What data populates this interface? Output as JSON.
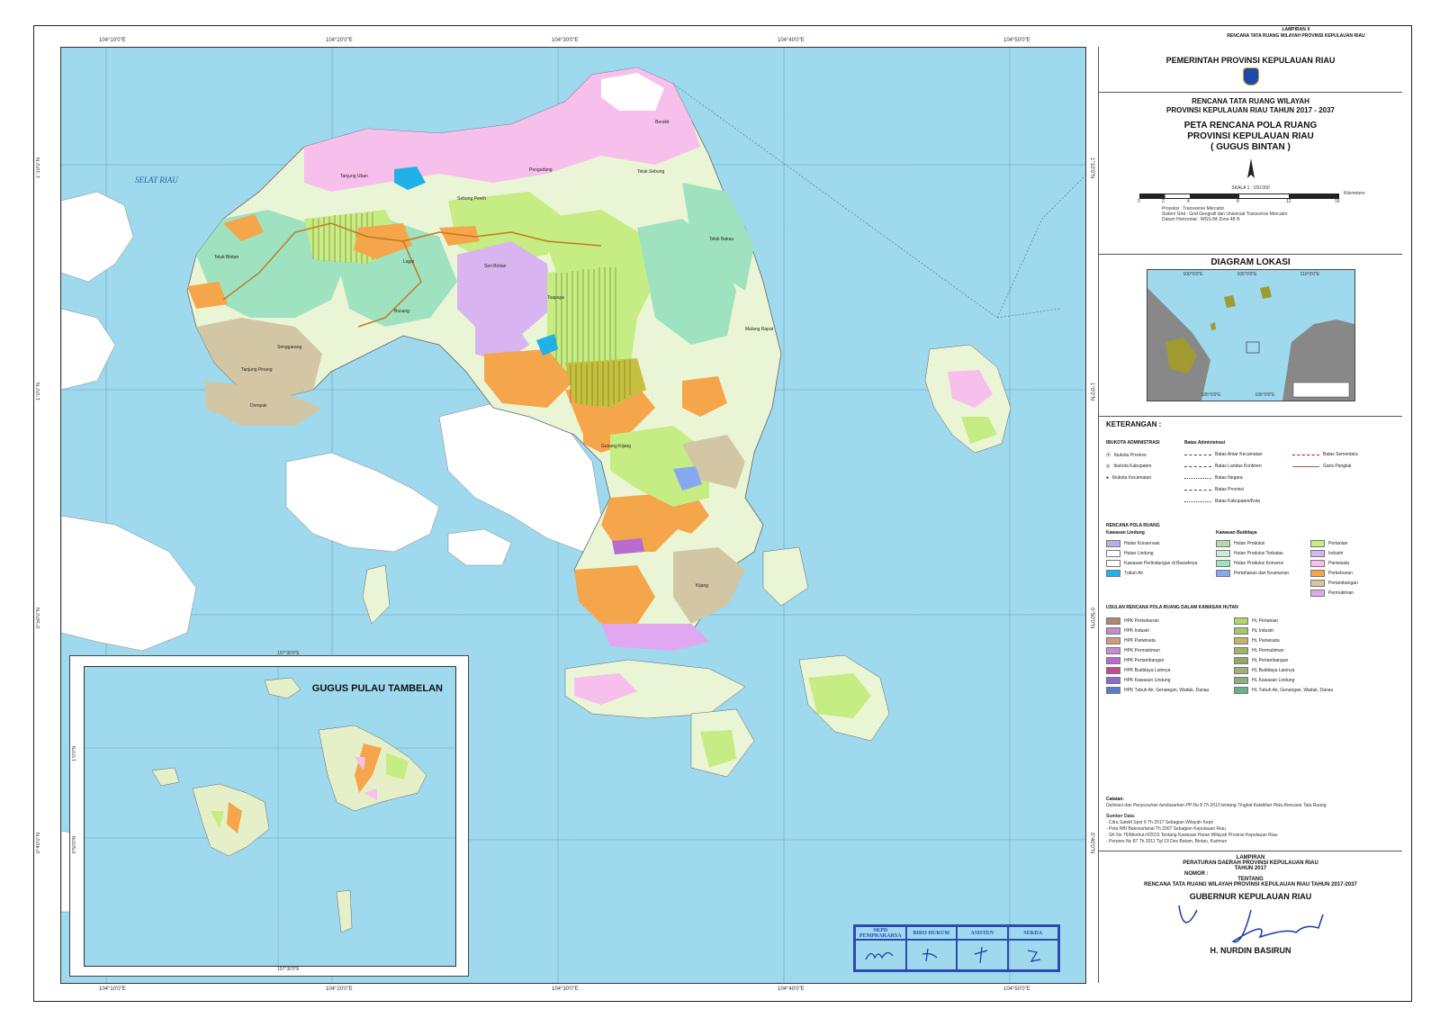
{
  "header": {
    "lampiran": "LAMPIRAN X",
    "rencana_header": "RENCANA TATA RUANG WILAYAH PROVINSI KEPULAUAN RIAU"
  },
  "map": {
    "coords_top": [
      "104°10'0\"E",
      "104°20'0\"E",
      "104°30'0\"E",
      "104°40'0\"E",
      "104°50'0\"E"
    ],
    "coords_bottom": [
      "104°10'0\"E",
      "104°20'0\"E",
      "104°30'0\"E",
      "104°40'0\"E",
      "104°50'0\"E"
    ],
    "coords_left": [
      "1°10'0\"N",
      "1°0'0\"N",
      "0°50'0\"N",
      "0°40'0\"N"
    ],
    "coords_right": [
      "1°10'0\"N",
      "1°0'0\"N",
      "0°50'0\"N",
      "0°40'0\"N"
    ],
    "sea_label": "SELAT RIAU",
    "places": [
      "Pengudang",
      "Tanjung Uban",
      "Sebong Pereh",
      "Teluk Sebong",
      "Lagoi",
      "Busung",
      "Teluk Bintan",
      "Seri Bintan",
      "Toapaya",
      "Kijang",
      "Tanjung Pinang",
      "Dompak",
      "Senggarang",
      "Teluk Bakau",
      "Gunung Kijang",
      "Malang Rapat",
      "Berakit"
    ],
    "colors": {
      "sea": "#9ed9ee",
      "protected_forest": "#b6d9a8",
      "production_forest": "#9ee2bf",
      "settlement": "#f7c0ec",
      "agriculture": "#c6ec84",
      "plantation": "#eaf5d5",
      "industry": "#d8b4f0",
      "mining": "#d2c6a5",
      "tourism": "#f5a54a",
      "water": "#1fb1e8",
      "white_land": "#ffffff",
      "tambelan_land": "#e6f0c8"
    }
  },
  "inset": {
    "title": "GUGUS PULAU TAMBELAN",
    "coord_top": "107°30'0\"E",
    "coord_bottom": "107°30'0\"E",
    "coord_left_1": "1°0'0\"N",
    "coord_left_2": "0°50'0\"N"
  },
  "signatures": {
    "headers": [
      "SKPD PEMPRAKARSA",
      "BIRO HUKUM",
      "ASISTEN",
      "SEKDA"
    ]
  },
  "sidebar": {
    "government": "PEMERINTAH PROVINSI KEPULAUAN RIAU",
    "plan_title_1": "RENCANA TATA RUANG WILAYAH",
    "plan_title_2": "PROVINSI KEPULAUAN RIAU TAHUN 2017 - 2037",
    "map_title_1": "PETA RENCANA POLA RUANG",
    "map_title_2": "PROVINSI KEPULAUAN RIAU",
    "map_title_3": "( GUGUS BINTAN )",
    "scale_text": "SKALA 1 : 150.000",
    "scale_ticks": [
      "0",
      "2",
      "4",
      "8",
      "12",
      "16"
    ],
    "scale_unit": "Kilometers",
    "projection": [
      {
        "label": "Proyeksi",
        "value": "Transverse Mercator"
      },
      {
        "label": "Sistem Grid",
        "value": "Grid Geografi dan Universal Transverse Mercator"
      },
      {
        "label": "Datum Horizontal",
        "value": "WGS 84 Zone 48 N"
      }
    ],
    "diagram_title": "DIAGRAM LOKASI",
    "legend_title": "KETERANGAN :",
    "admin_title": "IBUKOTA ADMINISTRASI",
    "admin_items": [
      "Ibukota Provinsi",
      "Ibukota Kabupaten",
      "Ibukota Kecamatan"
    ],
    "boundary_title": "Batas Administrasi",
    "boundary_items": [
      "Batas Antar Kecamatan",
      "Batas Landas Kontinen",
      "Batas Negara",
      "Batas Provinsi",
      "Batas Kabupaten/Kota"
    ],
    "boundary_items_right": [
      "Batas Sementara",
      "Garis Pangkal"
    ],
    "pola_title": "RENCANA POLA RUANG",
    "lindung_title": "Kawasan Lindung",
    "lindung_items": [
      {
        "label": "Hutan Konservasi",
        "color": "#b7b0e8"
      },
      {
        "label": "Hutan Lindung",
        "color": "#ffffff"
      },
      {
        "label": "Kawasan Perlindungan di Bawahnya",
        "color": "#ffffff"
      },
      {
        "label": "Tubuh Air",
        "color": "#1fb1e8"
      }
    ],
    "budidaya_title": "Kawasan Budidaya",
    "budidaya_items": [
      {
        "label": "Hutan Produksi",
        "color": "#b6d9a8"
      },
      {
        "label": "Hutan Produksi Terbatas",
        "color": "#c9ecd9"
      },
      {
        "label": "Hutan Produksi Konversi",
        "color": "#9ee2bf"
      },
      {
        "label": "Pertahanan dan Keamanan",
        "color": "#87a8f0"
      }
    ],
    "budidaya_items_right": [
      {
        "label": "Pertanian",
        "color": "#c6ec84"
      },
      {
        "label": "Industri",
        "color": "#d8b4f0"
      },
      {
        "label": "Pariwisata",
        "color": "#f7c0ec"
      },
      {
        "label": "Perkebunan",
        "color": "#f5a54a"
      },
      {
        "label": "Pertambangan",
        "color": "#d2c6a5"
      },
      {
        "label": "Permukiman",
        "color": "#e0a8f0"
      }
    ],
    "usulan_title": "USULAN RENCANA POLA RUANG DALAM KAWASAN HUTAN",
    "usulan_left": [
      "HPK Perkebunan",
      "HPK Industri",
      "HPK Pariwisata",
      "HPK Permukiman",
      "HPK Pertambangan",
      "HPK Budidaya Lainnya",
      "HPK Kawasan Lindung",
      "HPK Tubuh Air, Genangan, Waduk, Danau"
    ],
    "usulan_right": [
      "HL Pertanian",
      "HL Industri",
      "HL Pariwisata",
      "HL Permukiman",
      "HL Pertambangan",
      "HL Budidaya Lainnya",
      "HL Kawasan Lindung",
      "HL Tubuh Air, Genangan, Waduk, Danau"
    ],
    "usulan_colors": [
      "#b08a70",
      "#c48bd0",
      "#d69a80",
      "#c98ad8",
      "#b86bd0",
      "#c04a90",
      "#8e6ad0",
      "#5a7ad0"
    ],
    "usulan_colors_right": [
      "#b4d46a",
      "#a6c86a",
      "#c4b46a",
      "#a4b46a",
      "#94a86a",
      "#a0b07a",
      "#8ab07a",
      "#6ab08a"
    ],
    "catatan_title": "Catatan:",
    "catatan_text": "Deliniasi dan Penyusunan berdasarkan PP No 8 Th 2013 tentang Tingkat Ketelitian Peta Rencana Tata Ruang",
    "sumber_title": "Sumber Data:",
    "sumber_items": [
      "- Citra Satelit Spot 6 Th 2017 Sebagian Wilayah Kepri",
      "- Peta RBI Bakosurtanal Th 2007 Sebagian Kepulauan Riau",
      "- SK No 76/Menhut-II/2015 Tentang Kawasan Hutan Wilayah Provinsi Kepulauan Riau",
      "- Perpres No 87 Th 2011 Tgl 19 Des Batam, Bintan, Karimun"
    ],
    "lampiran": "LAMPIRAN",
    "perda_1": "PERATURAN DAERAH PROVINSI KEPULAUAN RIAU",
    "perda_2": "TAHUN 2017",
    "nomor": "NOMOR :",
    "tentang": "TENTANG",
    "perda_3": "RENCANA TATA RUANG WILAYAH PROVINSI KEPULAUAN RIAU TAHUN 2017-2037",
    "gubernur": "GUBERNUR KEPULAUAN RIAU",
    "gubernur_name": "H. NURDIN BASIRUN",
    "diagram_coords_top": [
      "100°0'0\"E",
      "105°0'0\"E",
      "110°0'0\"E"
    ],
    "diagram_coords_bottom": [
      "105°0'0\"E",
      "106°0'0\"E"
    ]
  }
}
